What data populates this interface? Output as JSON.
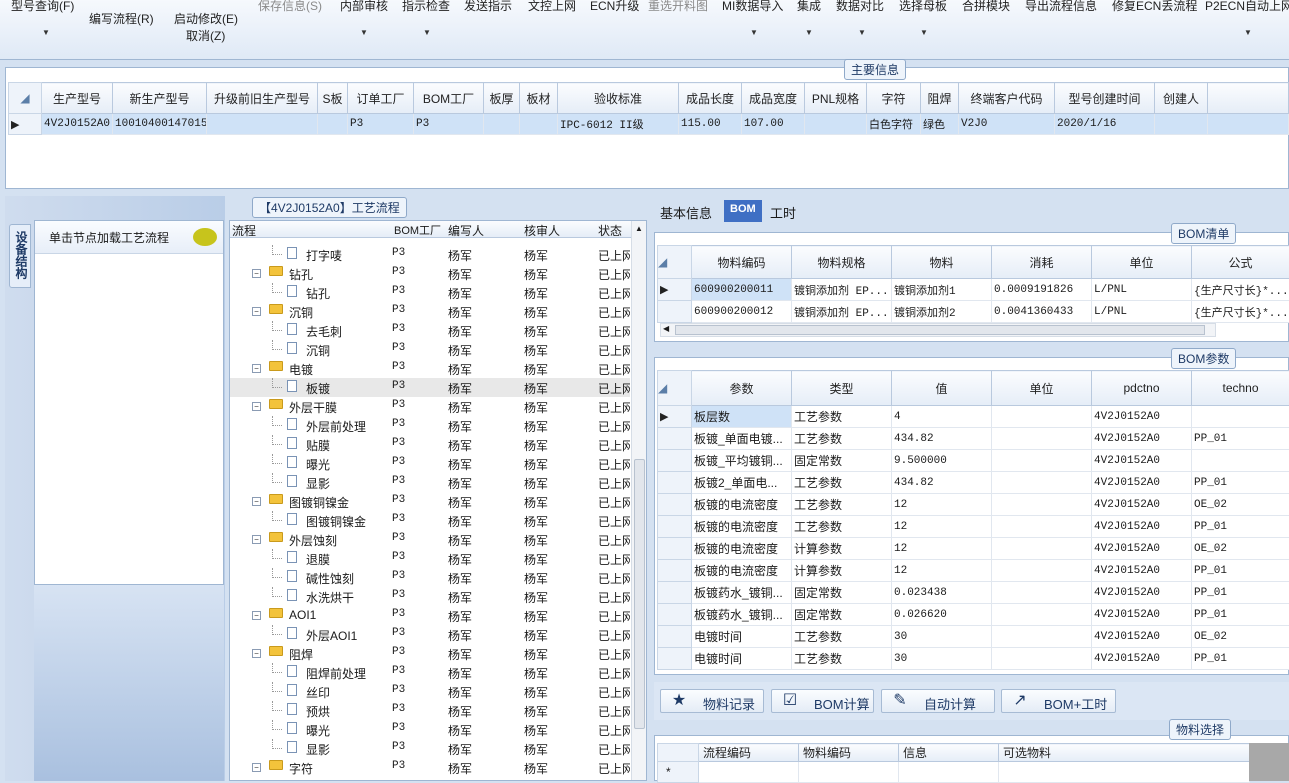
{
  "toolbar": {
    "item0": "型号查询(F)",
    "item1": "编写流程(R)",
    "item2": "启动修改(E)",
    "item2b": "取消(Z)",
    "item3": "保存信息(S)",
    "item4": "内部审核",
    "item5": "指示检查",
    "item6": "发送指示",
    "item7": "文控上网",
    "item8": "ECN升级",
    "item9": "重选开料图",
    "item10": "MI数据导入",
    "item11": "集成",
    "item12": "数据对比",
    "item13": "选择母板",
    "item14": "合拼模块",
    "item15": "导出流程信息",
    "item16": "修复ECN丢流程",
    "item17": "P2ECN自动上网"
  },
  "main_info": {
    "tag": "主要信息",
    "columns": [
      "生产型号",
      "新生产型号",
      "升级前旧生产型号",
      "S板",
      "订单工厂",
      "BOM工厂",
      "板厚",
      "板材",
      "验收标准",
      "成品长度",
      "成品宽度",
      "PNL规格",
      "字符",
      "阻焊",
      "终端客户代码",
      "型号创建时间",
      "创建人"
    ],
    "row": [
      "4V2J0152A0",
      "10010400147015",
      "",
      "",
      "P3",
      "P3",
      "",
      "",
      "IPC-6012 II级",
      "115.00",
      "107.00",
      "",
      "白色字符",
      "绿色",
      "V2J0",
      "2020/1/16",
      ""
    ]
  },
  "left_panel": {
    "vertical_tab": "设备结构",
    "node_hint": "单击节点加载工艺流程"
  },
  "tree": {
    "tag": "【4V2J0152A0】工艺流程",
    "columns": [
      "流程",
      "BOM工厂",
      "编写人",
      "核审人",
      "状态"
    ],
    "rows": [
      {
        "name": "打字唛",
        "factory": "P3",
        "writer": "杨军",
        "reviewer": "杨军",
        "status": "已上网",
        "type": "doc"
      },
      {
        "name": "钻孔",
        "factory": "P3",
        "writer": "杨军",
        "reviewer": "杨军",
        "status": "已上网",
        "type": "folder"
      },
      {
        "name": "钻孔",
        "factory": "P3",
        "writer": "杨军",
        "reviewer": "杨军",
        "status": "已上网",
        "type": "doc"
      },
      {
        "name": "沉铜",
        "factory": "P3",
        "writer": "杨军",
        "reviewer": "杨军",
        "status": "已上网",
        "type": "folder"
      },
      {
        "name": "去毛刺",
        "factory": "P3",
        "writer": "杨军",
        "reviewer": "杨军",
        "status": "已上网",
        "type": "doc"
      },
      {
        "name": "沉铜",
        "factory": "P3",
        "writer": "杨军",
        "reviewer": "杨军",
        "status": "已上网",
        "type": "doc"
      },
      {
        "name": "电镀",
        "factory": "P3",
        "writer": "杨军",
        "reviewer": "杨军",
        "status": "已上网",
        "type": "folder"
      },
      {
        "name": "板镀",
        "factory": "P3",
        "writer": "杨军",
        "reviewer": "杨军",
        "status": "已上网",
        "type": "doc",
        "sel": true
      },
      {
        "name": "外层干膜",
        "factory": "P3",
        "writer": "杨军",
        "reviewer": "杨军",
        "status": "已上网",
        "type": "folder"
      },
      {
        "name": "外层前处理",
        "factory": "P3",
        "writer": "杨军",
        "reviewer": "杨军",
        "status": "已上网",
        "type": "doc"
      },
      {
        "name": "贴膜",
        "factory": "P3",
        "writer": "杨军",
        "reviewer": "杨军",
        "status": "已上网",
        "type": "doc"
      },
      {
        "name": "曝光",
        "factory": "P3",
        "writer": "杨军",
        "reviewer": "杨军",
        "status": "已上网",
        "type": "doc"
      },
      {
        "name": "显影",
        "factory": "P3",
        "writer": "杨军",
        "reviewer": "杨军",
        "status": "已上网",
        "type": "doc"
      },
      {
        "name": "图镀铜镍金",
        "factory": "P3",
        "writer": "杨军",
        "reviewer": "杨军",
        "status": "已上网",
        "type": "folder"
      },
      {
        "name": "图镀铜镍金",
        "factory": "P3",
        "writer": "杨军",
        "reviewer": "杨军",
        "status": "已上网",
        "type": "doc"
      },
      {
        "name": "外层蚀刻",
        "factory": "P3",
        "writer": "杨军",
        "reviewer": "杨军",
        "status": "已上网",
        "type": "folder"
      },
      {
        "name": "退膜",
        "factory": "P3",
        "writer": "杨军",
        "reviewer": "杨军",
        "status": "已上网",
        "type": "doc"
      },
      {
        "name": "碱性蚀刻",
        "factory": "P3",
        "writer": "杨军",
        "reviewer": "杨军",
        "status": "已上网",
        "type": "doc"
      },
      {
        "name": "水洗烘干",
        "factory": "P3",
        "writer": "杨军",
        "reviewer": "杨军",
        "status": "已上网",
        "type": "doc"
      },
      {
        "name": "AOI1",
        "factory": "P3",
        "writer": "杨军",
        "reviewer": "杨军",
        "status": "已上网",
        "type": "folder"
      },
      {
        "name": "外层AOI1",
        "factory": "P3",
        "writer": "杨军",
        "reviewer": "杨军",
        "status": "已上网",
        "type": "doc"
      },
      {
        "name": "阻焊",
        "factory": "P3",
        "writer": "杨军",
        "reviewer": "杨军",
        "status": "已上网",
        "type": "folder"
      },
      {
        "name": "阻焊前处理",
        "factory": "P3",
        "writer": "杨军",
        "reviewer": "杨军",
        "status": "已上网",
        "type": "doc"
      },
      {
        "name": "丝印",
        "factory": "P3",
        "writer": "杨军",
        "reviewer": "杨军",
        "status": "已上网",
        "type": "doc"
      },
      {
        "name": "预烘",
        "factory": "P3",
        "writer": "杨军",
        "reviewer": "杨军",
        "status": "已上网",
        "type": "doc"
      },
      {
        "name": "曝光",
        "factory": "P3",
        "writer": "杨军",
        "reviewer": "杨军",
        "status": "已上网",
        "type": "doc"
      },
      {
        "name": "显影",
        "factory": "P3",
        "writer": "杨军",
        "reviewer": "杨军",
        "status": "已上网",
        "type": "doc"
      },
      {
        "name": "字符",
        "factory": "P3",
        "writer": "杨军",
        "reviewer": "杨军",
        "status": "已上网",
        "type": "folder"
      }
    ]
  },
  "right_tabs": [
    "基本信息",
    "BOM",
    "工时"
  ],
  "bom_list": {
    "tag": "BOM清单",
    "columns": [
      "物料编码",
      "物料规格",
      "物料",
      "消耗",
      "单位",
      "公式"
    ],
    "rows": [
      [
        "600900200011",
        "镀铜添加剂 EP...",
        "镀铜添加剂1",
        "0.0009191826",
        "L/PNL",
        "{生产尺寸长}*..."
      ],
      [
        "600900200012",
        "镀铜添加剂 EP...",
        "镀铜添加剂2",
        "0.0041360433",
        "L/PNL",
        "{生产尺寸长}*..."
      ]
    ]
  },
  "bom_params": {
    "tag": "BOM参数",
    "columns": [
      "参数",
      "类型",
      "值",
      "单位",
      "pdctno",
      "techno"
    ],
    "rows": [
      [
        "板层数",
        "工艺参数",
        "4",
        "",
        "4V2J0152A0",
        ""
      ],
      [
        "板镀_单面电镀...",
        "工艺参数",
        "434.82",
        "",
        "4V2J0152A0",
        "PP_01"
      ],
      [
        "板镀_平均镀铜...",
        "固定常数",
        "9.500000",
        "",
        "4V2J0152A0",
        ""
      ],
      [
        "板镀2_单面电...",
        "工艺参数",
        "434.82",
        "",
        "4V2J0152A0",
        "PP_01"
      ],
      [
        "板镀的电流密度",
        "工艺参数",
        "12",
        "",
        "4V2J0152A0",
        "OE_02"
      ],
      [
        "板镀的电流密度",
        "工艺参数",
        "12",
        "",
        "4V2J0152A0",
        "PP_01"
      ],
      [
        "板镀的电流密度",
        "计算参数",
        "12",
        "",
        "4V2J0152A0",
        "OE_02"
      ],
      [
        "板镀的电流密度",
        "计算参数",
        "12",
        "",
        "4V2J0152A0",
        "PP_01"
      ],
      [
        "板镀药水_镀铜...",
        "固定常数",
        "0.023438",
        "",
        "4V2J0152A0",
        "PP_01"
      ],
      [
        "板镀药水_镀铜...",
        "固定常数",
        "0.026620",
        "",
        "4V2J0152A0",
        "PP_01"
      ],
      [
        "电镀时间",
        "工艺参数",
        "30",
        "",
        "4V2J0152A0",
        "OE_02"
      ],
      [
        "电镀时间",
        "工艺参数",
        "30",
        "",
        "4V2J0152A0",
        "PP_01"
      ]
    ]
  },
  "buttons": {
    "material_record": "物料记录",
    "bom_calc": "BOM计算",
    "auto_calc": "自动计算",
    "bom_hours": "BOM+工时"
  },
  "material_select": {
    "tag": "物料选择",
    "columns": [
      "流程编码",
      "物料编码",
      "信息",
      "可选物料"
    ]
  }
}
